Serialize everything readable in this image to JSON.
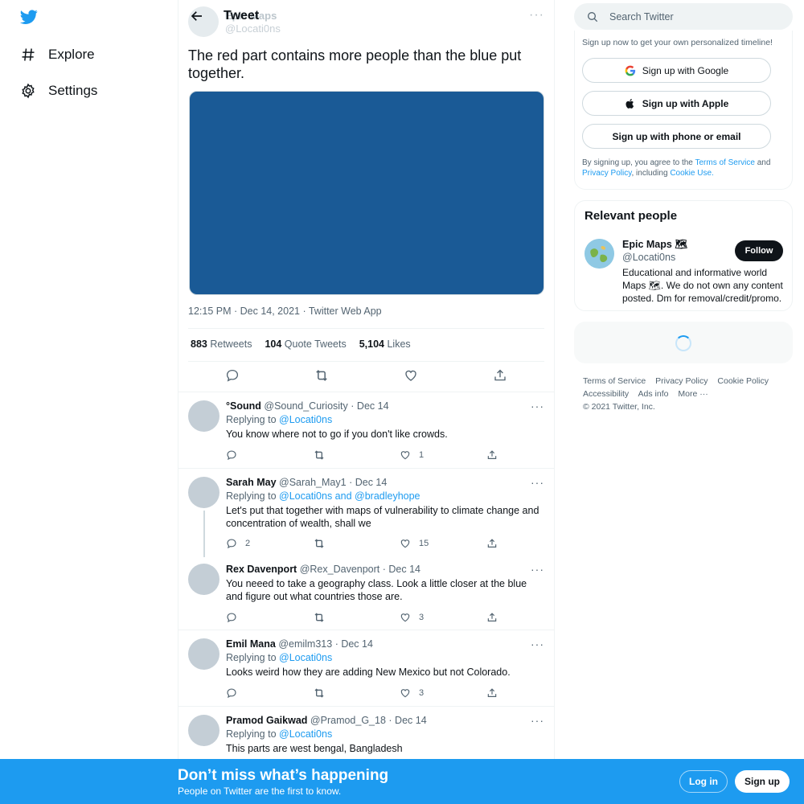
{
  "nav": {
    "logo": "twitter-bird-icon",
    "items": [
      {
        "label": "Explore",
        "icon": "hashtag-icon"
      },
      {
        "label": "Settings",
        "icon": "gear-icon"
      }
    ]
  },
  "header": {
    "title": "Tweet",
    "ghost_name": "Epic Maps",
    "ghost_handle": "@Locati0ns"
  },
  "tweet": {
    "text": "The red part contains more people than the blue put together.",
    "meta": "12:15 PM · Dec 14, 2021 · Twitter Web App",
    "stats": [
      {
        "count": "883",
        "label": "Retweets"
      },
      {
        "count": "104",
        "label": "Quote Tweets"
      },
      {
        "count": "5,104",
        "label": "Likes"
      }
    ],
    "media_color": "#1a5a96"
  },
  "replies": [
    {
      "name": "°Sound",
      "handle": "@Sound_Curiosity",
      "date": "· Dec 14",
      "replying_prefix": "Replying to ",
      "replying_to": "@Locati0ns",
      "text": "You know where not to go if you don't like crowds.",
      "replies": "",
      "retweets": "",
      "likes": "1"
    },
    {
      "name": "Sarah May",
      "handle": "@Sarah_May1",
      "date": "· Dec 14",
      "replying_prefix": "Replying to ",
      "replying_to": "@Locati0ns and @bradleyhope",
      "text": "Let's put that together with maps of vulnerability to climate change and concentration of wealth, shall we",
      "replies": "2",
      "retweets": "",
      "likes": "15"
    },
    {
      "name": "Rex Davenport",
      "handle": "@Rex_Davenport",
      "date": "· Dec 14",
      "replying_prefix": "",
      "replying_to": "",
      "text": "You neeed to take a geography class.  Look a little closer at the blue and figure out what countries those are.",
      "replies": "",
      "retweets": "",
      "likes": "3"
    },
    {
      "name": "Emil Mana",
      "handle": "@emilm313",
      "date": "· Dec 14",
      "replying_prefix": "Replying to ",
      "replying_to": "@Locati0ns",
      "text": "Looks weird how they are adding New Mexico but not Colorado.",
      "replies": "",
      "retweets": "",
      "likes": "3"
    },
    {
      "name": "Pramod Gaikwad",
      "handle": "@Pramod_G_18",
      "date": "· Dec 14",
      "replying_prefix": "Replying to ",
      "replying_to": "@Locati0ns",
      "text": "This parts are west bengal, Bangladesh",
      "replies": "",
      "retweets": "",
      "likes": ""
    }
  ],
  "search": {
    "placeholder": "Search Twitter"
  },
  "signup": {
    "intro": "Sign up now to get your own personalized timeline!",
    "google": "Sign up with Google",
    "apple": "Sign up with Apple",
    "phone": "Sign up with phone or email",
    "legal_pre": "By signing up, you agree to the ",
    "tos": "Terms of Service",
    "legal_and": " and ",
    "privacy": "Privacy Policy",
    "legal_mid": ", including ",
    "cookie": "Cookie Use."
  },
  "people": {
    "title": "Relevant people",
    "name": "Epic Maps 🗺",
    "handle": "@Locati0ns",
    "follow": "Follow",
    "bio": "Educational and informative world Maps 🗺. We do not own any content posted. Dm for removal/credit/promo."
  },
  "footer": {
    "links": [
      "Terms of Service",
      "Privacy Policy",
      "Cookie Policy",
      "Accessibility",
      "Ads info",
      "More ···"
    ],
    "copyright": "© 2021 Twitter, Inc."
  },
  "banner": {
    "title": "Don’t miss what’s happening",
    "subtitle": "People on Twitter are the first to know.",
    "login": "Log in",
    "signup": "Sign up"
  }
}
